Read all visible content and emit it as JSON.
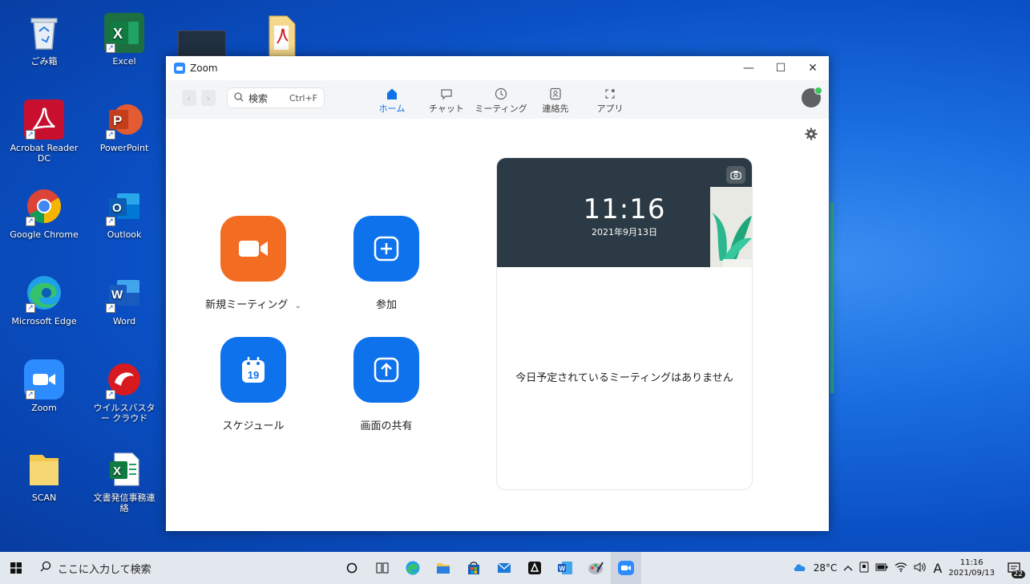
{
  "desktop": {
    "icons": [
      {
        "label": "ごみ箱"
      },
      {
        "label": "Excel"
      },
      {
        "label": "Acrobat Reader DC"
      },
      {
        "label": "PowerPoint"
      },
      {
        "label": "Google Chrome"
      },
      {
        "label": "Outlook"
      },
      {
        "label": "Microsoft Edge"
      },
      {
        "label": "Word"
      },
      {
        "label": "Zoom"
      },
      {
        "label": "ウイルスバスター クラウド"
      },
      {
        "label": "SCAN"
      },
      {
        "label": "文書発信事務連絡"
      }
    ]
  },
  "zoom": {
    "title": "Zoom",
    "search": {
      "placeholder": "検索",
      "shortcut": "Ctrl+F"
    },
    "tabs": [
      {
        "label": "ホーム",
        "icon": "home-icon",
        "active": true
      },
      {
        "label": "チャット",
        "icon": "chat-icon"
      },
      {
        "label": "ミーティング",
        "icon": "clock-icon"
      },
      {
        "label": "連絡先",
        "icon": "contacts-icon"
      },
      {
        "label": "アプリ",
        "icon": "apps-icon"
      }
    ],
    "actions": {
      "new_meeting": "新規ミーティング",
      "join": "参加",
      "schedule": "スケジュール",
      "share_screen": "画面の共有",
      "calendar_day": "19"
    },
    "card": {
      "time": "11:16",
      "date": "2021年9月13日",
      "no_meetings": "今日予定されているミーティングはありません"
    },
    "colors": {
      "accent": "#0e72ed",
      "new_meeting": "#f26d21",
      "card_header": "#2b3a44"
    }
  },
  "taskbar": {
    "search_placeholder": "ここに入力して検索",
    "weather": "28°C",
    "ime": "A",
    "time": "11:16",
    "date": "2021/09/13",
    "notifications": "22"
  }
}
